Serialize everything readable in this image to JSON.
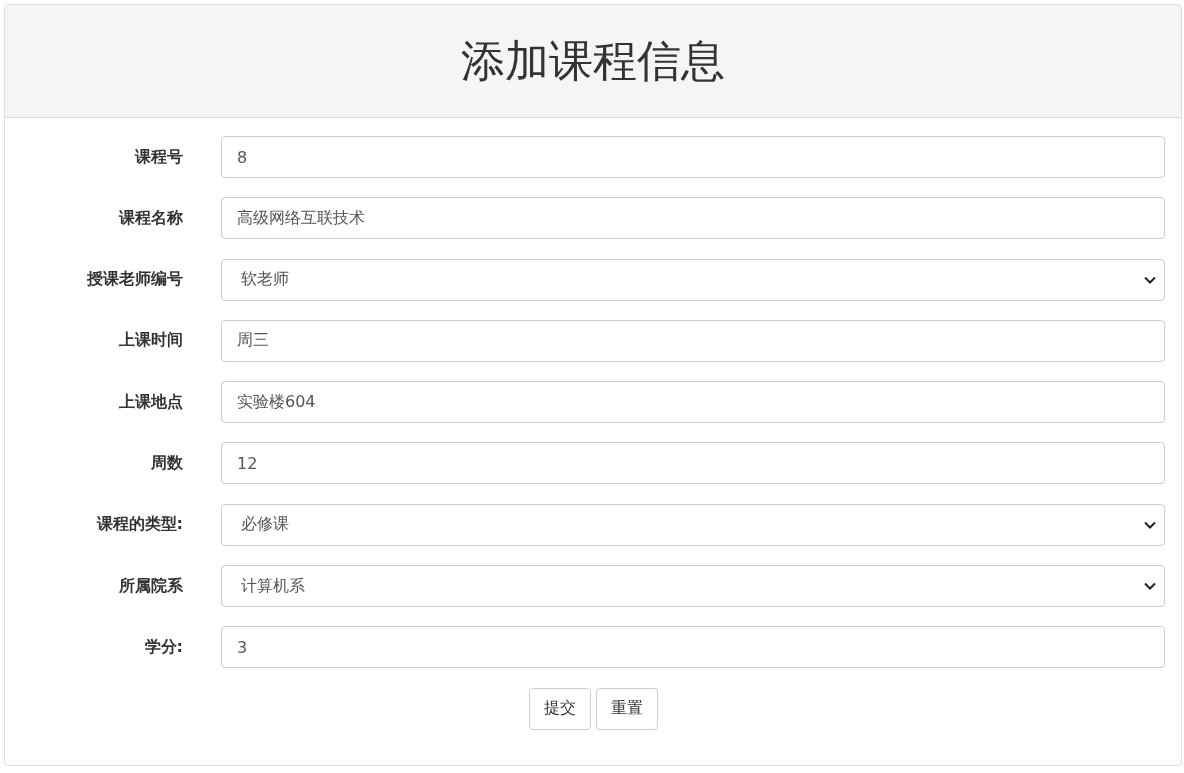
{
  "title": "添加课程信息",
  "fields": [
    {
      "label": "课程号",
      "kind": "input",
      "value": "8"
    },
    {
      "label": "课程名称",
      "kind": "input",
      "value": "高级网络互联技术"
    },
    {
      "label": "授课老师编号",
      "kind": "select",
      "value": "软老师"
    },
    {
      "label": "上课时间",
      "kind": "input",
      "value": "周三"
    },
    {
      "label": "上课地点",
      "kind": "input",
      "value": "实验楼604"
    },
    {
      "label": "周数",
      "kind": "input",
      "value": "12"
    },
    {
      "label": "课程的类型:",
      "kind": "select",
      "value": "必修课"
    },
    {
      "label": "所属院系",
      "kind": "select",
      "value": "计算机系"
    },
    {
      "label": "学分:",
      "kind": "input",
      "value": "3"
    }
  ],
  "buttons": [
    "提交",
    "重置"
  ]
}
